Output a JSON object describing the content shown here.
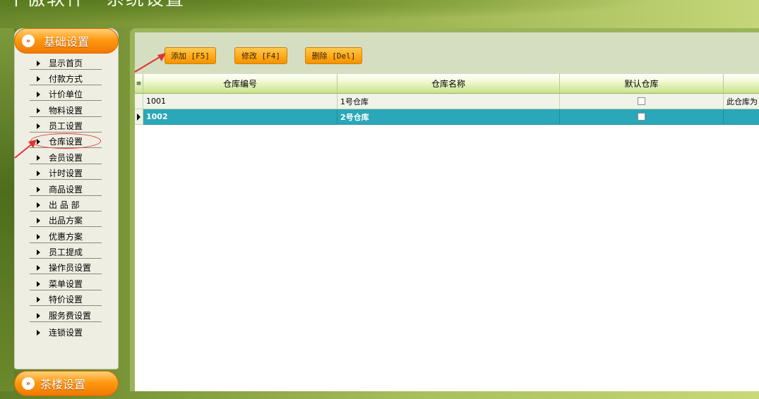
{
  "app": {
    "title_left": "千傲软件",
    "title_right": "系统设置"
  },
  "sidebar": {
    "section_title": "基础设置",
    "items": [
      {
        "label": "显示首页"
      },
      {
        "label": "付款方式"
      },
      {
        "label": "计价单位"
      },
      {
        "label": "物料设置"
      },
      {
        "label": "员工设置"
      },
      {
        "label": "仓库设置"
      },
      {
        "label": "会员设置"
      },
      {
        "label": "计时设置"
      },
      {
        "label": "商品设置"
      },
      {
        "label": "出 品 部"
      },
      {
        "label": "出品方案"
      },
      {
        "label": "优惠方案"
      },
      {
        "label": "员工提成"
      },
      {
        "label": "操作员设置"
      },
      {
        "label": "菜单设置"
      },
      {
        "label": "特价设置"
      },
      {
        "label": "服务费设置"
      },
      {
        "label": "连锁设置"
      }
    ],
    "section2_title": "茶楼设置"
  },
  "toolbar": {
    "add_label": "添加 [F5]",
    "edit_label": "修改 [F4]",
    "delete_label": "删除 [Del]"
  },
  "grid": {
    "columns": [
      "仓库编号",
      "仓库名称",
      "默认仓库",
      ""
    ],
    "rows": [
      {
        "code": "1001",
        "name": "1号仓库",
        "default": false,
        "note": "此仓库为"
      },
      {
        "code": "1002",
        "name": "2号仓库",
        "default": false,
        "note": ""
      }
    ]
  },
  "colors": {
    "accent_orange": "#ff9a12",
    "selected_row": "#2aa7b8",
    "annotation_red": "#e23232"
  }
}
